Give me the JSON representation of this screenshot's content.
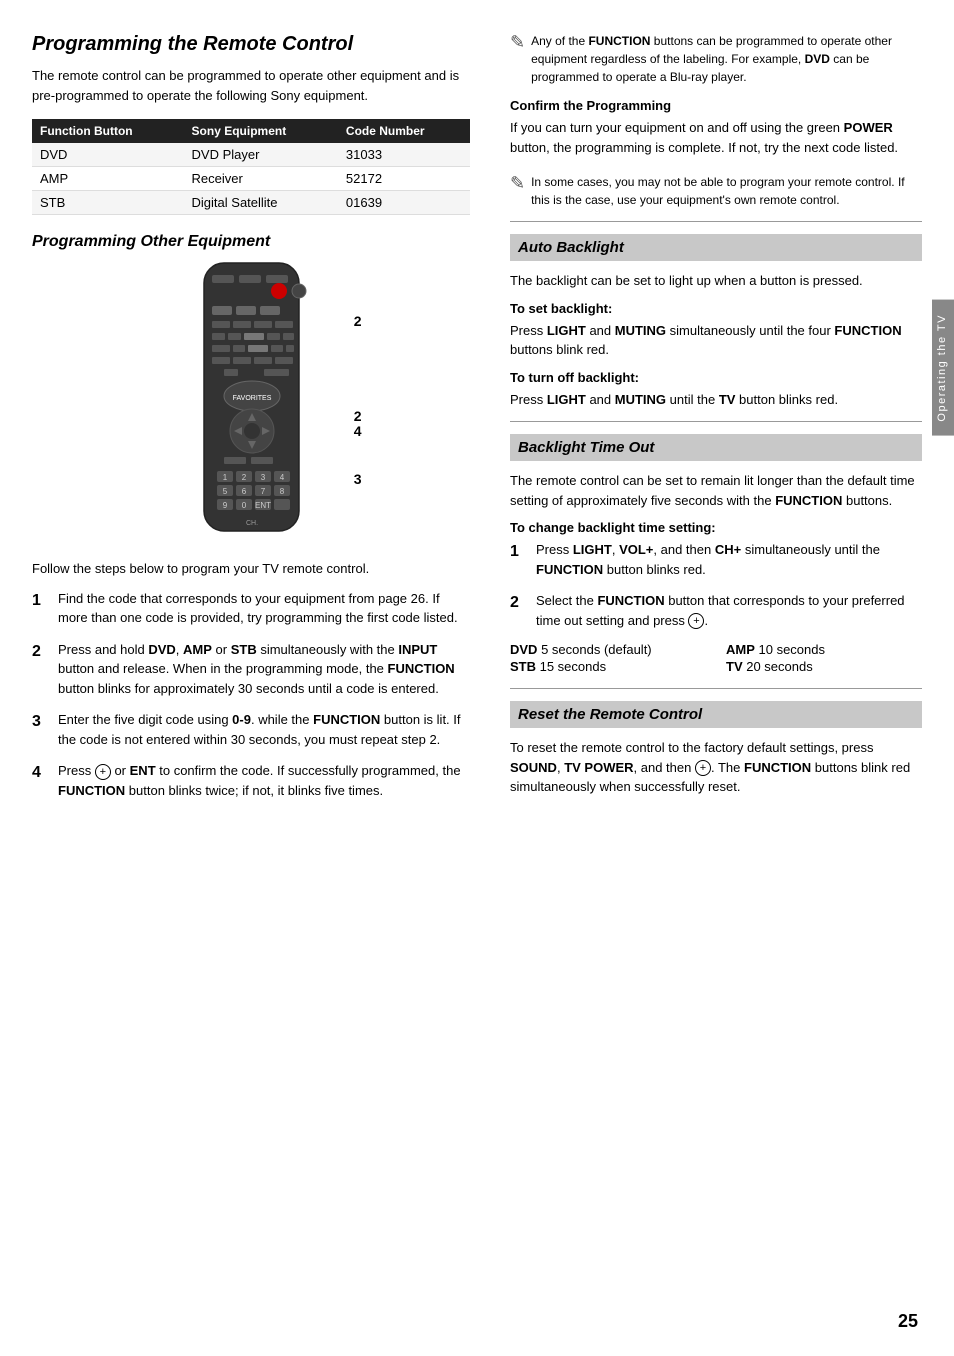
{
  "page": {
    "title": "Programming the Remote Control",
    "intro": "The remote control can be programmed to operate other equipment and is pre-programmed to operate the following Sony equipment.",
    "table": {
      "headers": [
        "Function Button",
        "Sony Equipment",
        "Code Number"
      ],
      "rows": [
        [
          "DVD",
          "DVD Player",
          "31033"
        ],
        [
          "AMP",
          "Receiver",
          "52172"
        ],
        [
          "STB",
          "Digital Satellite",
          "01639"
        ]
      ]
    },
    "section2_title": "Programming Other Equipment",
    "steps_intro": "Follow the steps below to program your TV remote control.",
    "steps": [
      "Find the code that corresponds to your equipment from page 26. If more than one code is provided, try programming the first code listed.",
      "Press and hold DVD, AMP or STB simultaneously with the INPUT button and release. When in the programming mode, the FUNCTION button blinks for approximately 30 seconds until a code is entered.",
      "Enter the five digit code using 0-9. while the FUNCTION button is lit. If the code is not entered within 30 seconds, you must repeat step 2.",
      "Press  or ENT to confirm the code. If successfully programmed, the FUNCTION button blinks twice; if not, it blinks five times."
    ],
    "callouts": [
      "2",
      "2\n4",
      "3"
    ],
    "right": {
      "note1": "Any of the FUNCTION buttons can be programmed to operate other equipment regardless of the labeling. For example, DVD can be programmed to operate a Blu-ray player.",
      "confirm_title": "Confirm the Programming",
      "confirm_text": "If you can turn your equipment on and off using the green POWER button, the programming is complete. If not, try the next code listed.",
      "note2": "In some cases, you may not be able to program your remote control. If this is the case, use your equipment's own remote control.",
      "autobacklight_title": "Auto Backlight",
      "autobacklight_text": "The backlight can be set to light up when a button is pressed.",
      "set_backlight_heading": "To set backlight:",
      "set_backlight_text": "Press LIGHT and MUTING simultaneously until the four FUNCTION buttons blink red.",
      "turn_off_heading": "To turn off backlight:",
      "turn_off_text": "Press LIGHT and MUTING until the TV button blinks red.",
      "backlight_timeout_title": "Backlight Time Out",
      "backlight_timeout_text": "The remote control can be set to remain lit longer than the default time setting of approximately five seconds with the FUNCTION buttons.",
      "change_heading": "To change backlight time setting:",
      "change_steps": [
        "Press LIGHT, VOL+, and then CH+ simultaneously until the FUNCTION button blinks red.",
        "Select the FUNCTION button that corresponds to your preferred time out setting and press ."
      ],
      "time_table": [
        {
          "label": "DVD",
          "value": "5 seconds (default)"
        },
        {
          "label": "AMP",
          "value": "10 seconds"
        },
        {
          "label": "STB",
          "value": "15 seconds"
        },
        {
          "label": "TV",
          "value": "20 seconds"
        }
      ],
      "reset_title": "Reset the Remote Control",
      "reset_text": "To reset the remote control to the factory default settings, press SOUND, TV POWER, and then . The FUNCTION buttons blink red simultaneously when successfully reset."
    },
    "side_label": "Operating the TV",
    "page_number": "25"
  }
}
